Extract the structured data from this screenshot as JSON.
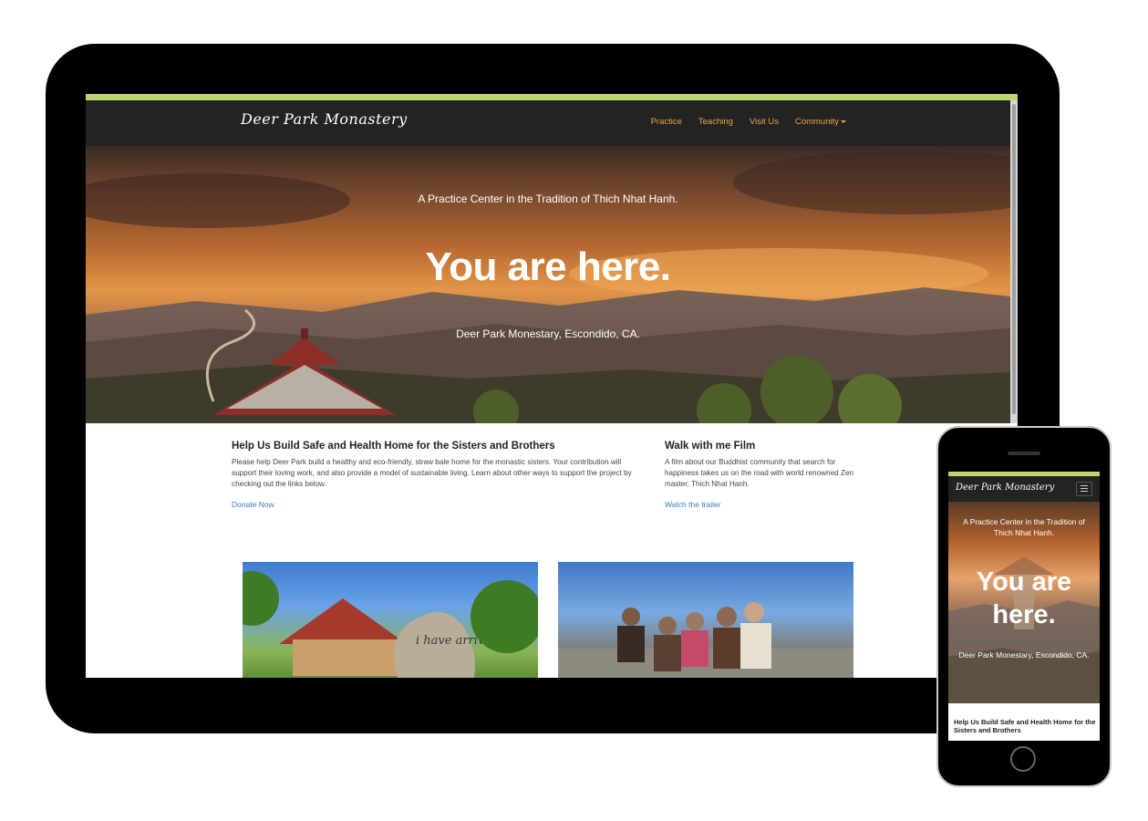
{
  "site": {
    "logo": "Deer Park Monastery",
    "nav": [
      "Practice",
      "Teaching",
      "Visit Us",
      "Community"
    ],
    "accent_color": "#bfd56f",
    "nav_link_color": "#e8a44a"
  },
  "hero": {
    "subtitle": "A Practice Center in the Tradition of Thich Nhat Hanh.",
    "title": "You are here.",
    "location": "Deer Park Monestary, Escondido, CA."
  },
  "sections": [
    {
      "heading": "Help Us Build Safe and Health Home for the Sisters and Brothers",
      "body": "Please help Deer Park build a healthy and eco-friendly, straw bale home for the monastic sisters. Your contribution will support their loving work, and also provide a model of sustainable living. Learn about other ways to support the project by checking out the links below.",
      "link": "Donate Now"
    },
    {
      "heading": "Walk with me Film",
      "body": "A film about our Buddhist community that search for happiness takes us on the road with world renowned Zen master, Thich Nhat Hanh.",
      "link": "Watch the trailer"
    }
  ],
  "photos": [
    {
      "name": "meditation-hall-and-stone",
      "stone_text": "i have arrived i am"
    },
    {
      "name": "monastic-community-group"
    }
  ],
  "mobile": {
    "logo": "Deer Park Monastery",
    "menu_icon": "hamburger-icon",
    "hero_title_lines": [
      "You are",
      "here."
    ],
    "first_heading": "Help Us Build Safe and Health Home for the Sisters and Brothers"
  }
}
